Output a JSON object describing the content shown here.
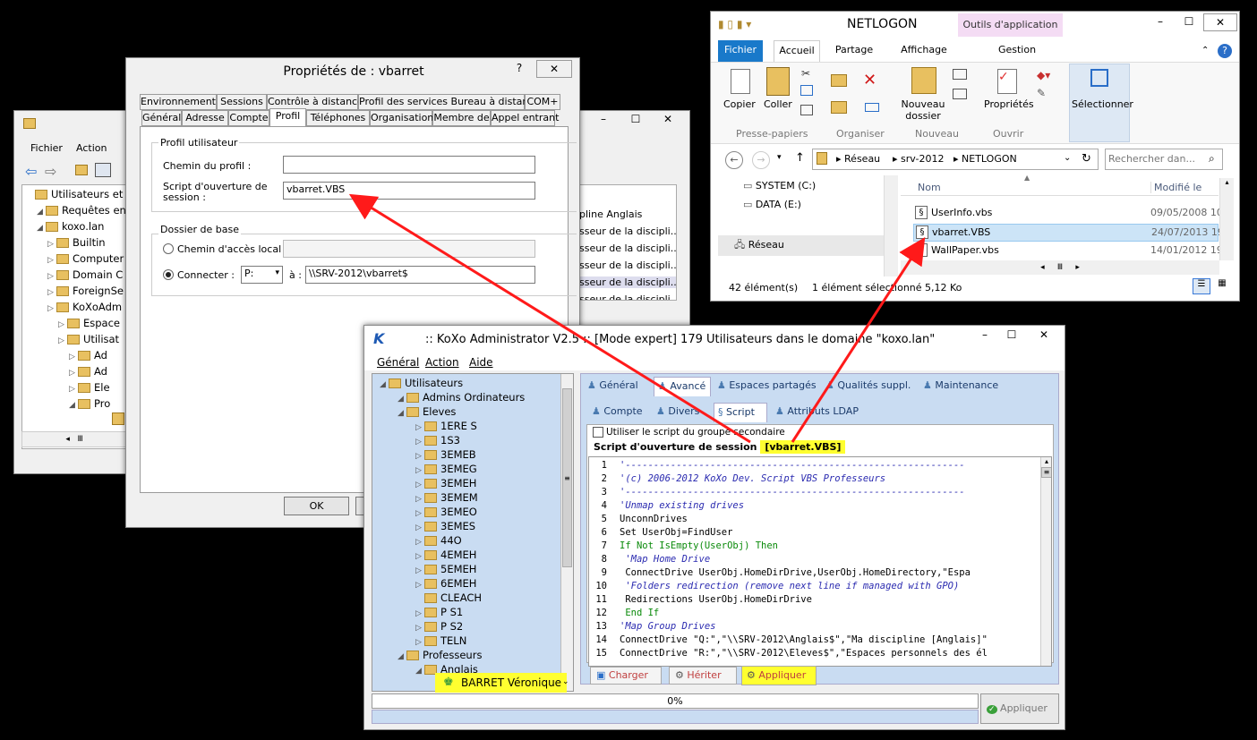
{
  "aduc": {
    "menu": [
      "Fichier",
      "Action"
    ],
    "tree": [
      {
        "label": "Utilisateurs et ord",
        "indent": 0
      },
      {
        "label": "Requêtes enre",
        "indent": 1
      },
      {
        "label": "koxo.lan",
        "indent": 1
      },
      {
        "label": "Builtin",
        "indent": 2
      },
      {
        "label": "Computer",
        "indent": 2
      },
      {
        "label": "Domain C",
        "indent": 2
      },
      {
        "label": "ForeignSe",
        "indent": 2
      },
      {
        "label": "KoXoAdm",
        "indent": 2
      },
      {
        "label": "Espace",
        "indent": 3
      },
      {
        "label": "Utilisat",
        "indent": 3
      },
      {
        "label": "Ad",
        "indent": 4
      },
      {
        "label": "Ad",
        "indent": 4
      },
      {
        "label": "Ele",
        "indent": 4
      },
      {
        "label": "Pro",
        "indent": 4
      }
    ],
    "right_rows": [
      "pline Anglais",
      "sseur de la discipli...",
      "sseur de la discipli...",
      "sseur de la discipli...",
      "sseur de la discipli...",
      "sseur de la discipli..."
    ]
  },
  "props": {
    "title": "Propriétés de : vbarret",
    "help": "?",
    "close": "✕",
    "tabs_row1": [
      "Environnement",
      "Sessions",
      "Contrôle à distance",
      "Profil des services Bureau à distance",
      "COM+"
    ],
    "tabs_row2": [
      "Général",
      "Adresse",
      "Compte",
      "Profil",
      "Téléphones",
      "Organisation",
      "Membre de",
      "Appel entrant"
    ],
    "group1": "Profil utilisateur",
    "profile_path_label": "Chemin du profil :",
    "script_label": "Script d'ouverture de session :",
    "script_value": "vbarret.VBS",
    "group2": "Dossier de base",
    "local_path_label": "Chemin d'accès local :",
    "connect_label": "Connecter :",
    "drive": "P:",
    "to_label": "à :",
    "connect_value": "\\\\SRV-2012\\vbarret$",
    "ok": "OK"
  },
  "explorer": {
    "title": "NETLOGON",
    "context_tab": "Outils d'application",
    "ribbon_tabs": [
      "Fichier",
      "Accueil",
      "Partage",
      "Affichage",
      "Gestion"
    ],
    "ribbon": {
      "copy": "Copier",
      "paste": "Coller",
      "clipboard_group": "Presse-papiers",
      "organize_group": "Organiser",
      "new_folder": "Nouveau dossier",
      "new_group": "Nouveau",
      "properties": "Propriétés",
      "open_group": "Ouvrir",
      "select": "Sélectionner"
    },
    "path": [
      "Réseau",
      "srv-2012",
      "NETLOGON"
    ],
    "search_placeholder": "Rechercher dan...",
    "nav": [
      "SYSTEM (C:)",
      "DATA (E:)",
      "Réseau"
    ],
    "col_name": "Nom",
    "col_modified": "Modifié le",
    "files": [
      {
        "name": "UserInfo.vbs",
        "date": "09/05/2008 10:"
      },
      {
        "name": "vbarret.VBS",
        "date": "24/07/2013 19:"
      },
      {
        "name": "WallPaper.vbs",
        "date": "14/01/2012 19:"
      }
    ],
    "status_count": "42 élément(s)",
    "status_sel": "1 élément sélectionné  5,12 Ko"
  },
  "koxo": {
    "title": ":: KoXo Administrator V2.5 :: [Mode expert] 179 Utilisateurs dans le domaine \"koxo.lan\"",
    "menu": [
      "Général",
      "Action",
      "Aide"
    ],
    "tree": [
      {
        "label": "Utilisateurs",
        "indent": 0
      },
      {
        "label": "Admins Ordinateurs",
        "indent": 1
      },
      {
        "label": "Eleves",
        "indent": 1
      },
      {
        "label": "1ERE S",
        "indent": 2
      },
      {
        "label": "1S3",
        "indent": 2
      },
      {
        "label": "3EMEB",
        "indent": 2
      },
      {
        "label": "3EMEG",
        "indent": 2
      },
      {
        "label": "3EMEH",
        "indent": 2
      },
      {
        "label": "3EMEM",
        "indent": 2
      },
      {
        "label": "3EMEO",
        "indent": 2
      },
      {
        "label": "3EMES",
        "indent": 2
      },
      {
        "label": "44O",
        "indent": 2
      },
      {
        "label": "4EMEH",
        "indent": 2
      },
      {
        "label": "5EMEH",
        "indent": 2
      },
      {
        "label": "6EMEH",
        "indent": 2
      },
      {
        "label": "CLEACH",
        "indent": 2
      },
      {
        "label": "P S1",
        "indent": 2
      },
      {
        "label": "P S2",
        "indent": 2
      },
      {
        "label": "TELN",
        "indent": 2
      },
      {
        "label": "Professeurs",
        "indent": 1
      },
      {
        "label": "Anglais",
        "indent": 2
      }
    ],
    "selected_user": "BARRET Véronique",
    "top_tabs": [
      "Général",
      "Avancé",
      "Espaces partagés",
      "Qualités suppl.",
      "Maintenance"
    ],
    "sub_tabs": [
      "Compte",
      "Divers",
      "Script",
      "Attributs LDAP"
    ],
    "checkbox_label": "Utiliser le script du groupe secondaire",
    "script_heading": "Script d'ouverture de session",
    "script_file": "[vbarret.VBS]",
    "code": [
      {
        "n": "1",
        "t": "'------------------------------------------------------------",
        "c": "cmt"
      },
      {
        "n": "2",
        "t": "'(c) 2006-2012 KoXo Dev. Script VBS Professeurs",
        "c": "cmt"
      },
      {
        "n": "3",
        "t": "'------------------------------------------------------------",
        "c": "cmt"
      },
      {
        "n": "4",
        "t": "'Unmap existing drives",
        "c": "cmt"
      },
      {
        "n": "5",
        "t": "UnconnDrives",
        "c": ""
      },
      {
        "n": "6",
        "t": "Set UserObj=FindUser",
        "c": ""
      },
      {
        "n": "7",
        "t": "If Not IsEmpty(UserObj) Then",
        "c": "kw"
      },
      {
        "n": "8",
        "t": "   'Map Home Drive",
        "c": "cmt"
      },
      {
        "n": "9",
        "t": "   ConnectDrive UserObj.HomeDirDrive,UserObj.HomeDirectory,\"Espa",
        "c": ""
      },
      {
        "n": "10",
        "t": "   'Folders redirection (remove next line if managed with GPO)",
        "c": "cmt"
      },
      {
        "n": "11",
        "t": "   Redirections UserObj.HomeDirDrive",
        "c": ""
      },
      {
        "n": "12",
        "t": "  End If",
        "c": "kw"
      },
      {
        "n": "13",
        "t": "'Map Group Drives",
        "c": "cmt"
      },
      {
        "n": "14",
        "t": "ConnectDrive \"Q:\",\"\\\\SRV-2012\\Anglais$\",\"Ma discipline [Anglais]\"",
        "c": ""
      },
      {
        "n": "15",
        "t": "ConnectDrive \"R:\",\"\\\\SRV-2012\\Eleves$\",\"Espaces personnels des él",
        "c": ""
      }
    ],
    "buttons": [
      "Charger",
      "Hériter",
      "Appliquer"
    ],
    "progress": "0%",
    "apply": "Appliquer"
  },
  "colors": {
    "highlight": "#ffff30",
    "arrow": "#ff1a1a",
    "koxo_blue": "#c9dcf2"
  }
}
